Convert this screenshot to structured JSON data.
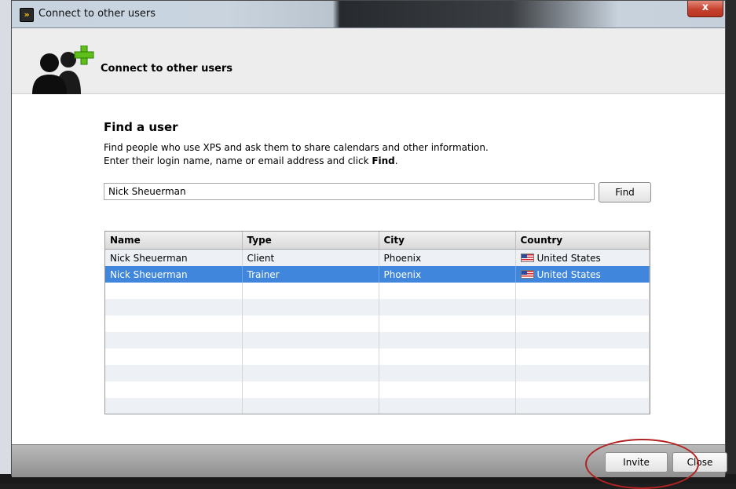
{
  "window": {
    "title": "Connect to other users",
    "close_symbol": "x"
  },
  "header": {
    "title": "Connect to other users",
    "icon": "users-add-icon"
  },
  "find": {
    "heading": "Find a user",
    "description_line1": "Find people who use XPS and ask them to share calendars and other information.",
    "description_line2_prefix": "Enter their login name, name or email address and click ",
    "description_line2_bold": "Find",
    "description_line2_suffix": ".",
    "search_value": "Nick Sheuerman",
    "find_label": "Find"
  },
  "results": {
    "columns": [
      "Name",
      "Type",
      "City",
      "Country"
    ],
    "rows": [
      {
        "name": "Nick Sheuerman",
        "type": "Client",
        "city": "Phoenix",
        "country": "United States"
      },
      {
        "name": "Nick Sheuerman",
        "type": "Trainer",
        "city": "Phoenix",
        "country": "United States"
      }
    ],
    "selected_index": 1
  },
  "footer": {
    "invite_label": "Invite",
    "close_label": "Close"
  },
  "colors": {
    "selection": "#3f86dc",
    "highlight_circle": "#b22222"
  }
}
